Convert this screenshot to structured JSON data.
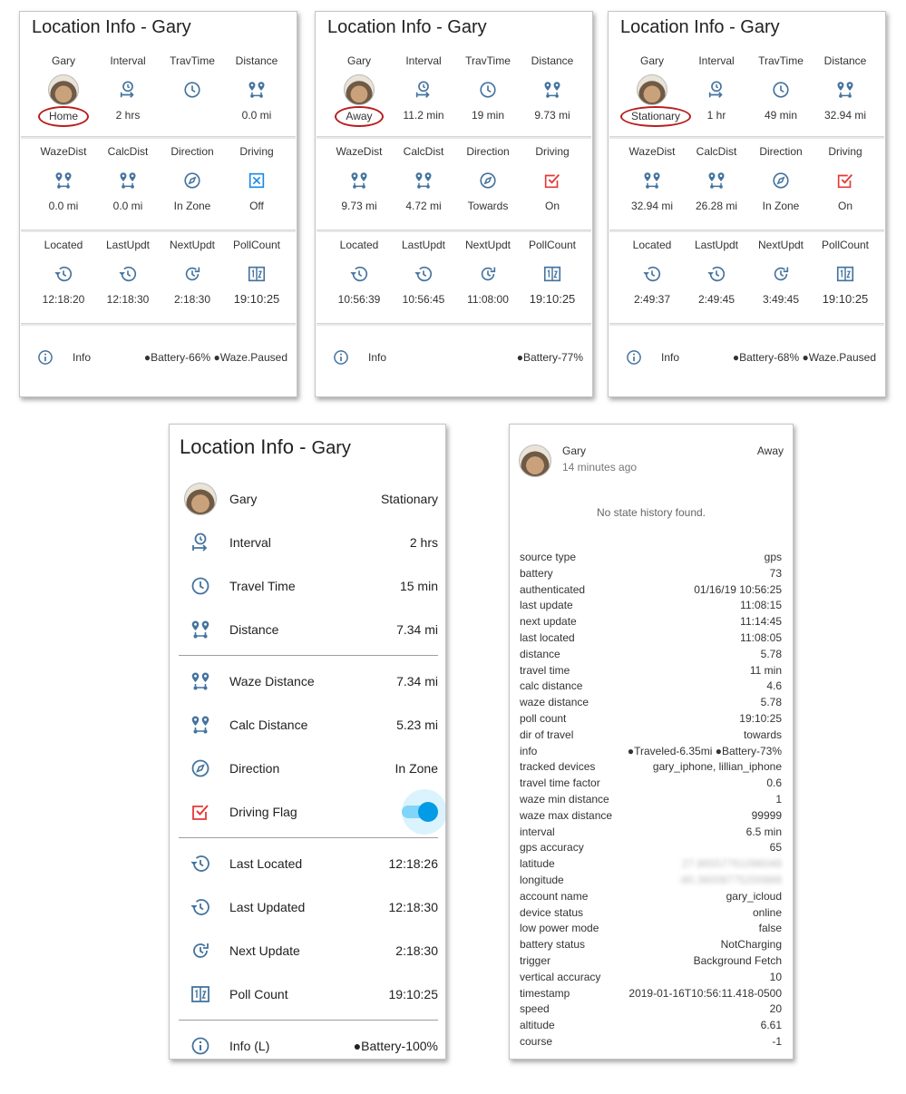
{
  "colors": {
    "icon_blue": "#44739e",
    "driving_red": "#e53935",
    "ellipse_red": "#b91d1d",
    "toggle_blue": "#039be5"
  },
  "glance_cards": [
    {
      "title": "Location Info - Gary",
      "row1": [
        {
          "name": "Gary",
          "icon": "avatar",
          "state": "Home"
        },
        {
          "name": "Interval",
          "icon": "timer-arrow-icon",
          "state": "2 hrs"
        },
        {
          "name": "TravTime",
          "icon": "clock-icon",
          "state": ""
        },
        {
          "name": "Distance",
          "icon": "map-marker-distance-icon",
          "state": "0.0 mi"
        }
      ],
      "row2": [
        {
          "name": "WazeDist",
          "icon": "map-marker-distance-icon",
          "state": "0.0 mi"
        },
        {
          "name": "CalcDist",
          "icon": "map-marker-distance-icon",
          "state": "0.0 mi"
        },
        {
          "name": "Direction",
          "icon": "compass-icon",
          "state": "In Zone"
        },
        {
          "name": "Driving",
          "icon": "checkbox-off-icon",
          "state": "Off"
        }
      ],
      "row3": [
        {
          "name": "Located",
          "icon": "history-icon",
          "state": "12:18:20"
        },
        {
          "name": "LastUpdt",
          "icon": "history-icon",
          "state": "12:18:30"
        },
        {
          "name": "NextUpdt",
          "icon": "update-icon",
          "state": "2:18:30"
        },
        {
          "name": "PollCount",
          "icon": "counter-icon",
          "state": "19:10:25"
        }
      ],
      "info_label": "Info",
      "info_value": "●Battery-66% ●Waze.Paused"
    },
    {
      "title": "Location Info - Gary",
      "row1": [
        {
          "name": "Gary",
          "icon": "avatar",
          "state": "Away"
        },
        {
          "name": "Interval",
          "icon": "timer-arrow-icon",
          "state": "11.2 min"
        },
        {
          "name": "TravTime",
          "icon": "clock-icon",
          "state": "19 min"
        },
        {
          "name": "Distance",
          "icon": "map-marker-distance-icon",
          "state": "9.73 mi"
        }
      ],
      "row2": [
        {
          "name": "WazeDist",
          "icon": "map-marker-distance-icon",
          "state": "9.73 mi"
        },
        {
          "name": "CalcDist",
          "icon": "map-marker-distance-icon",
          "state": "4.72 mi"
        },
        {
          "name": "Direction",
          "icon": "compass-icon",
          "state": "Towards"
        },
        {
          "name": "Driving",
          "icon": "checkbox-on-icon",
          "state": "On"
        }
      ],
      "row3": [
        {
          "name": "Located",
          "icon": "history-icon",
          "state": "10:56:39"
        },
        {
          "name": "LastUpdt",
          "icon": "history-icon",
          "state": "10:56:45"
        },
        {
          "name": "NextUpdt",
          "icon": "update-icon",
          "state": "11:08:00"
        },
        {
          "name": "PollCount",
          "icon": "counter-icon",
          "state": "19:10:25"
        }
      ],
      "info_label": "Info",
      "info_value": "●Battery-77%"
    },
    {
      "title": "Location Info - Gary",
      "row1": [
        {
          "name": "Gary",
          "icon": "avatar",
          "state": "Stationary"
        },
        {
          "name": "Interval",
          "icon": "timer-arrow-icon",
          "state": "1 hr"
        },
        {
          "name": "TravTime",
          "icon": "clock-icon",
          "state": "49 min"
        },
        {
          "name": "Distance",
          "icon": "map-marker-distance-icon",
          "state": "32.94 mi"
        }
      ],
      "row2": [
        {
          "name": "WazeDist",
          "icon": "map-marker-distance-icon",
          "state": "32.94 mi"
        },
        {
          "name": "CalcDist",
          "icon": "map-marker-distance-icon",
          "state": "26.28 mi"
        },
        {
          "name": "Direction",
          "icon": "compass-icon",
          "state": "In Zone"
        },
        {
          "name": "Driving",
          "icon": "checkbox-on-icon",
          "state": "On"
        }
      ],
      "row3": [
        {
          "name": "Located",
          "icon": "history-icon",
          "state": "2:49:37"
        },
        {
          "name": "LastUpdt",
          "icon": "history-icon",
          "state": "2:49:45"
        },
        {
          "name": "NextUpdt",
          "icon": "update-icon",
          "state": "3:49:45"
        },
        {
          "name": "PollCount",
          "icon": "counter-icon",
          "state": "19:10:25"
        }
      ],
      "info_label": "Info",
      "info_value": "●Battery-68% ●Waze.Paused"
    }
  ],
  "entities_card": {
    "title_main": "Location Info - ",
    "title_name": "Gary",
    "groups": [
      [
        {
          "icon": "avatar",
          "label": "Gary",
          "value": "Stationary"
        },
        {
          "icon": "timer-arrow-icon",
          "label": "Interval",
          "value": "2 hrs"
        },
        {
          "icon": "clock-icon",
          "label": "Travel Time",
          "value": "15 min"
        },
        {
          "icon": "map-marker-distance-icon",
          "label": "Distance",
          "value": "7.34 mi"
        }
      ],
      [
        {
          "icon": "map-marker-distance-icon",
          "label": "Waze Distance",
          "value": "7.34 mi"
        },
        {
          "icon": "map-marker-distance-icon",
          "label": "Calc Distance",
          "value": "5.23 mi"
        },
        {
          "icon": "compass-icon",
          "label": "Direction",
          "value": "In Zone"
        },
        {
          "icon": "checkbox-on-icon",
          "label": "Driving Flag",
          "value": "",
          "toggle": "on"
        }
      ],
      [
        {
          "icon": "history-icon",
          "label": "Last Located",
          "value": "12:18:26"
        },
        {
          "icon": "history-icon",
          "label": "Last Updated",
          "value": "12:18:30"
        },
        {
          "icon": "update-icon",
          "label": "Next Update",
          "value": "2:18:30"
        },
        {
          "icon": "counter-icon",
          "label": "Poll Count",
          "value": "19:10:25"
        }
      ],
      [
        {
          "icon": "info-icon",
          "label": "Info (L)",
          "value": "●Battery-100%"
        }
      ]
    ]
  },
  "more_info_dialog": {
    "name": "Gary",
    "time_ago": "14 minutes ago",
    "state": "Away",
    "no_history": "No state history found.",
    "attributes": [
      [
        "source type",
        "gps"
      ],
      [
        "battery",
        "73"
      ],
      [
        "authenticated",
        "01/16/19 10:56:25"
      ],
      [
        "last update",
        "11:08:15"
      ],
      [
        "next update",
        "11:14:45"
      ],
      [
        "last located",
        "11:08:05"
      ],
      [
        "distance",
        "5.78"
      ],
      [
        "travel time",
        "11 min"
      ],
      [
        "calc distance",
        "4.6"
      ],
      [
        "waze distance",
        "5.78"
      ],
      [
        "poll count",
        "19:10:25"
      ],
      [
        "dir of travel",
        "towards"
      ],
      [
        "info",
        "●Traveled-6.35mi ●Battery-73%"
      ],
      [
        "tracked devices",
        "gary_iphone, lillian_iphone"
      ],
      [
        "travel time factor",
        "0.6"
      ],
      [
        "waze min distance",
        "1"
      ],
      [
        "waze max distance",
        "99999"
      ],
      [
        "interval",
        "6.5 min"
      ],
      [
        "gps accuracy",
        "65"
      ],
      [
        "latitude",
        "27.86557761096048"
      ],
      [
        "longitude",
        "-80.36008775200888"
      ],
      [
        "account name",
        "gary_icloud"
      ],
      [
        "device status",
        "online"
      ],
      [
        "low power mode",
        "false"
      ],
      [
        "battery status",
        "NotCharging"
      ],
      [
        "trigger",
        "Background Fetch"
      ],
      [
        "vertical accuracy",
        "10"
      ],
      [
        "timestamp",
        "2019-01-16T10:56:11.418-0500"
      ],
      [
        "speed",
        "20"
      ],
      [
        "altitude",
        "6.61"
      ],
      [
        "course",
        "-1"
      ]
    ],
    "blurred_keys": [
      "latitude",
      "longitude"
    ]
  }
}
